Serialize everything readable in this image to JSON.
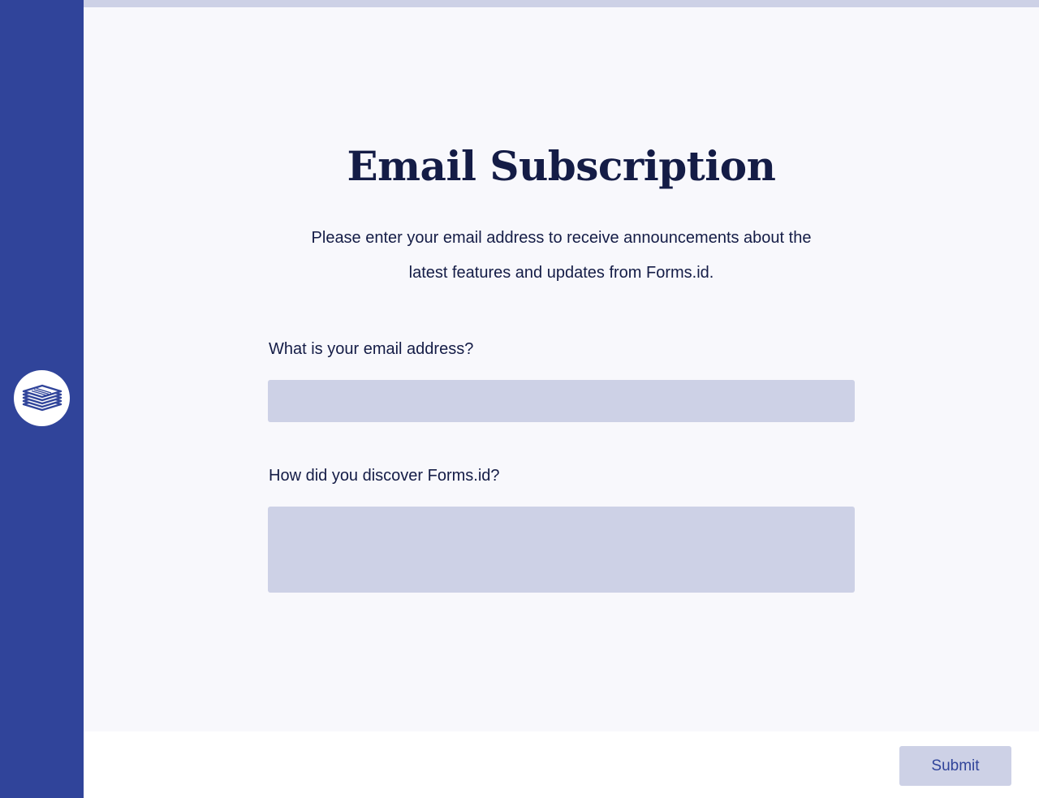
{
  "app": {
    "logo_icon": "stacked-papers-icon"
  },
  "form": {
    "title": "Email Subscription",
    "description_line1": "Please enter your email address to receive announcements about the",
    "description_line2": "latest features and updates from Forms.id.",
    "fields": [
      {
        "label": "What is your email address?",
        "value": "",
        "placeholder": ""
      },
      {
        "label": "How did you discover Forms.id?",
        "value": "",
        "placeholder": ""
      }
    ]
  },
  "footer": {
    "submit_label": "Submit"
  },
  "colors": {
    "sidebar": "#30449a",
    "accent": "#30449a",
    "field_bg": "#cdd1e6",
    "text": "#141c46",
    "page_bg": "#f8f8fc"
  }
}
